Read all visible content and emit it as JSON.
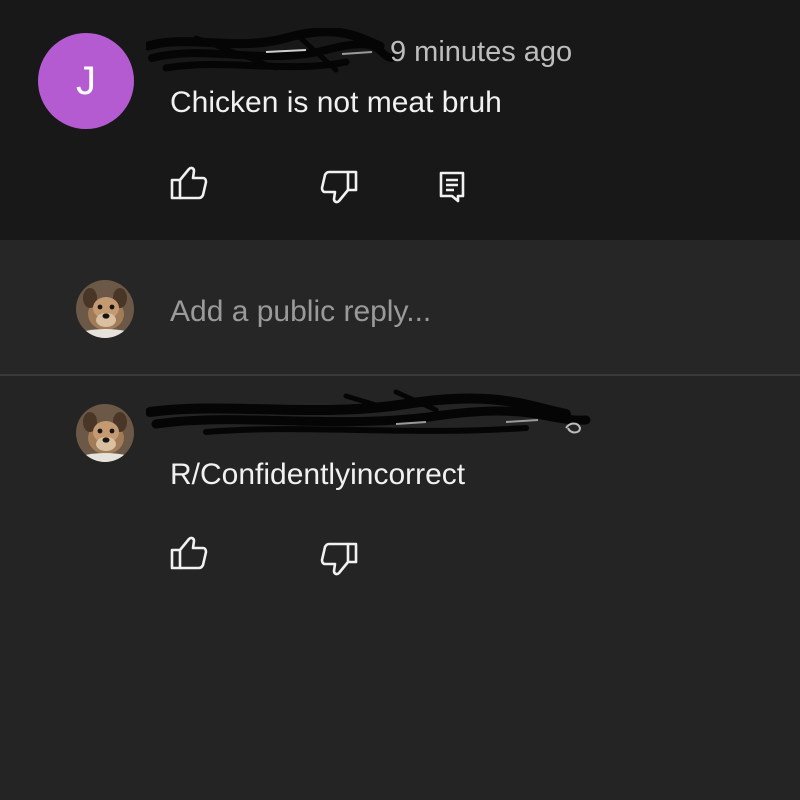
{
  "comment": {
    "avatar_letter": "J",
    "avatar_color": "#b45bd2",
    "time": "9 minutes ago",
    "text": "Chicken is not meat bruh",
    "actions": [
      {
        "icon": "thumbs-up-icon"
      },
      {
        "icon": "thumbs-down-icon"
      },
      {
        "icon": "reply-icon"
      }
    ]
  },
  "reply_box": {
    "placeholder": "Add a public reply..."
  },
  "reply": {
    "text": "R/Confidentlyincorrect",
    "actions": [
      {
        "icon": "thumbs-up-icon"
      },
      {
        "icon": "thumbs-down-icon"
      }
    ]
  },
  "colors": {
    "background": "#242424",
    "comment_background": "#181818",
    "text": "#f1f1f1",
    "meta_text": "#bdbdbd",
    "placeholder": "#9a9a9a"
  }
}
